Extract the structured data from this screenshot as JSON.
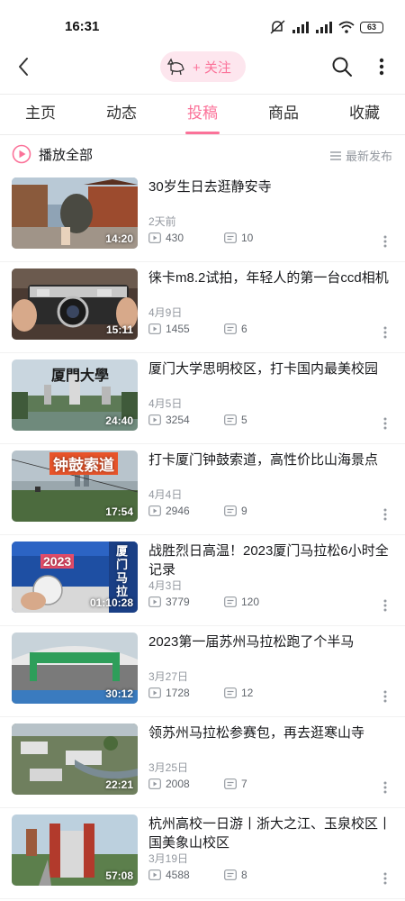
{
  "status_bar": {
    "time": "16:31",
    "battery": "63"
  },
  "nav": {
    "follow_label": "+ 关注"
  },
  "tabs": [
    {
      "label": "主页"
    },
    {
      "label": "动态"
    },
    {
      "label": "投稿"
    },
    {
      "label": "商品"
    },
    {
      "label": "收藏"
    }
  ],
  "active_tab": "投稿",
  "list_header": {
    "play_all": "播放全部",
    "sort": "最新发布"
  },
  "videos": [
    {
      "title": "30岁生日去逛静安寺",
      "date": "2天前",
      "views": "430",
      "comments": "10",
      "duration": "14:20"
    },
    {
      "title": "徕卡m8.2试拍，年轻人的第一台ccd相机",
      "date": "4月9日",
      "views": "1455",
      "comments": "6",
      "duration": "15:11"
    },
    {
      "title": "厦门大学思明校区，打卡国内最美校园",
      "date": "4月5日",
      "views": "3254",
      "comments": "5",
      "duration": "24:40",
      "caption": "厦門大學"
    },
    {
      "title": "打卡厦门钟鼓索道，高性价比山海景点",
      "date": "4月4日",
      "views": "2946",
      "comments": "9",
      "duration": "17:54",
      "caption": "钟鼓索道"
    },
    {
      "title": "战胜烈日高温！2023厦门马拉松6小时全记录",
      "date": "4月3日",
      "views": "3779",
      "comments": "120",
      "duration": "01:10:28",
      "caption_top": "2023",
      "caption_side": "厦门马拉"
    },
    {
      "title": "2023第一届苏州马拉松跑了个半马",
      "date": "3月27日",
      "views": "1728",
      "comments": "12",
      "duration": "30:12"
    },
    {
      "title": "领苏州马拉松参赛包，再去逛寒山寺",
      "date": "3月25日",
      "views": "2008",
      "comments": "7",
      "duration": "22:21"
    },
    {
      "title": "杭州高校一日游丨浙大之江、玉泉校区丨国美象山校区",
      "date": "3月19日",
      "views": "4588",
      "comments": "8",
      "duration": "57:08"
    }
  ],
  "colors": {
    "accent": "#fb7299",
    "accent_bg": "#fde6ee",
    "muted": "#9499a0",
    "text": "#18191c"
  },
  "icons": {
    "back": "chevron-left-icon",
    "search": "search-icon",
    "more": "more-vertical-icon",
    "play_all": "play-circle-icon",
    "sort": "list-sort-icon",
    "views": "play-count-icon",
    "comments": "danmaku-icon"
  }
}
